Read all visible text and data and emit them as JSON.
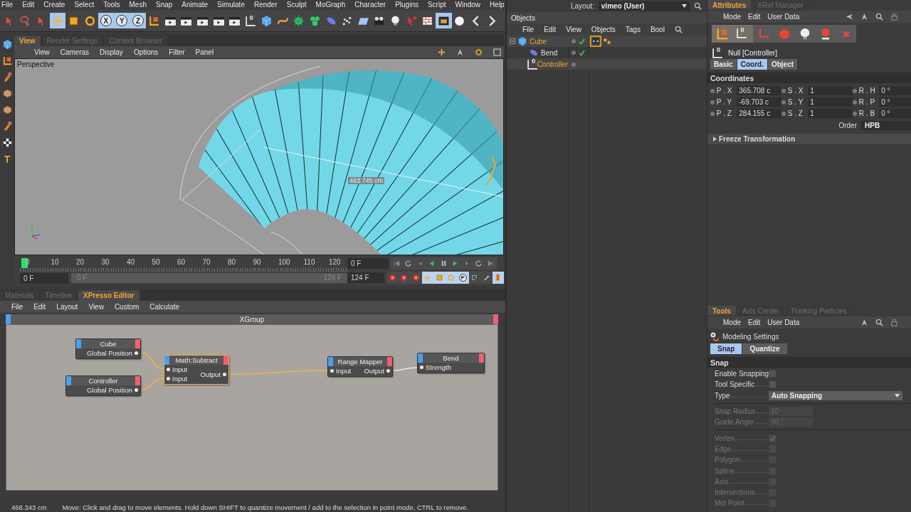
{
  "menubar": [
    "File",
    "Edit",
    "Create",
    "Select",
    "Tools",
    "Mesh",
    "Snap",
    "Animate",
    "Simulate",
    "Render",
    "Sculpt",
    "MoGraph",
    "Character",
    "Plugins",
    "Script",
    "Window",
    "Help"
  ],
  "toolbar": [
    {
      "kind": "select",
      "selected": false
    },
    {
      "kind": "lasso",
      "selected": false
    },
    {
      "kind": "select",
      "selected": false
    },
    {
      "kind": "move",
      "selected": true
    },
    {
      "kind": "scale",
      "selected": false
    },
    {
      "kind": "rotate",
      "selected": false
    },
    {
      "kind": "axis",
      "label": "X",
      "selected": true
    },
    {
      "kind": "axis",
      "label": "Y",
      "selected": true
    },
    {
      "kind": "axis",
      "label": "Z",
      "selected": true
    },
    {
      "kind": "coords",
      "selected": false
    },
    {
      "kind": "clapper",
      "selected": false
    },
    {
      "kind": "clapper",
      "selected": false
    },
    {
      "kind": "clapper",
      "selected": false
    },
    {
      "kind": "clapper",
      "selected": false
    },
    {
      "kind": "clapper",
      "selected": false
    },
    {
      "kind": "null",
      "label": "0",
      "selected": false
    },
    {
      "kind": "cube",
      "selected": false
    },
    {
      "kind": "spline",
      "selected": false
    },
    {
      "kind": "nurbs",
      "selected": false
    },
    {
      "kind": "array",
      "selected": false
    },
    {
      "kind": "deformer",
      "selected": false
    },
    {
      "kind": "particles",
      "selected": false
    },
    {
      "kind": "plane",
      "selected": false
    },
    {
      "kind": "camera",
      "selected": false
    },
    {
      "kind": "light",
      "selected": false
    },
    {
      "kind": "help",
      "selected": false
    },
    {
      "kind": "bricks",
      "selected": false
    },
    {
      "kind": "view",
      "selected": true
    },
    {
      "kind": "sphere",
      "selected": false
    },
    {
      "kind": "prev",
      "selected": false
    },
    {
      "kind": "next",
      "selected": false
    }
  ],
  "left_tools": [
    {
      "kind": "cube"
    },
    {
      "kind": "coords"
    },
    {
      "kind": "brush"
    },
    {
      "kind": "poly"
    },
    {
      "kind": "poly"
    },
    {
      "kind": "brush"
    },
    {
      "kind": "checker"
    },
    {
      "kind": "glyph",
      "label": "T"
    }
  ],
  "viewport": {
    "tabs": [
      {
        "label": "View",
        "selected": true
      },
      {
        "label": "Render Settings",
        "selected": false
      },
      {
        "label": "Content Browser",
        "selected": false
      }
    ],
    "menu": [
      "View",
      "Cameras",
      "Display",
      "Options",
      "Filter",
      "Panel"
    ],
    "camera": "Perspective",
    "measurement": "463.745 cm"
  },
  "timeline": {
    "ruler": [
      "0",
      "10",
      "20",
      "30",
      "40",
      "50",
      "60",
      "70",
      "80",
      "90",
      "100",
      "110",
      "120"
    ],
    "playhead": {
      "level": 0
    },
    "current_field": "0 F",
    "end_field": "124 F",
    "start_field": "0 F",
    "range_start": "0 F",
    "range_end": "124 F",
    "transport": [
      {
        "kind": "first",
        "selected": false
      },
      {
        "kind": "loop",
        "selected": false
      },
      {
        "kind": "prevkey",
        "selected": false
      },
      {
        "kind": "playback",
        "selected": false
      },
      {
        "kind": "pause",
        "selected": false
      },
      {
        "kind": "play",
        "selected": false
      },
      {
        "kind": "nextkey",
        "selected": false
      },
      {
        "kind": "loop",
        "selected": false
      },
      {
        "kind": "last",
        "selected": false
      }
    ],
    "keys": [
      {
        "kind": "record",
        "selected": false
      },
      {
        "kind": "record",
        "selected": false
      },
      {
        "kind": "record",
        "selected": false
      },
      {
        "kind": "move",
        "selected": true
      },
      {
        "kind": "scale",
        "selected": true
      },
      {
        "kind": "rotate",
        "selected": true
      },
      {
        "kind": "param",
        "label": "P",
        "selected": true
      },
      {
        "kind": "grid",
        "selected": false
      },
      {
        "kind": "key",
        "selected": false
      },
      {
        "kind": "film",
        "selected": true
      }
    ]
  },
  "bottom": {
    "tabs": [
      {
        "label": "Materials",
        "selected": false
      },
      {
        "label": "Timeline",
        "selected": false
      },
      {
        "label": "XPresso Editor",
        "selected": true
      }
    ],
    "menu": [
      "File",
      "Edit",
      "Layout",
      "View",
      "Custom",
      "Calculate"
    ],
    "xgroup": {
      "title": "XGroup",
      "nodes": [
        {
          "title": "Cube",
          "selected": false,
          "outputs": [
            "Global Position"
          ]
        },
        {
          "title": "Controller",
          "selected": false,
          "outputs": [
            "Global Position"
          ]
        },
        {
          "title": "Math:Subtract",
          "selected": true,
          "inputs": [
            "Input",
            "Input"
          ],
          "outputs": [
            "Output"
          ]
        },
        {
          "title": "Range Mapper",
          "selected": false,
          "inputs": [
            "Input"
          ],
          "outputs": [
            "Output"
          ]
        },
        {
          "title": "Bend",
          "selected": false,
          "inputs": [
            "Strength"
          ]
        }
      ],
      "wires": [
        {
          "selected": true
        },
        {
          "selected": true
        },
        {
          "selected": true
        },
        {
          "selected": false
        }
      ]
    }
  },
  "status": {
    "reading": "468.343 cm",
    "message": "Move: Click and drag to move elements. Hold down SHIFT to quantize movement / add to the selection in point mode, CTRL to remove."
  },
  "layout": {
    "label": "Layout:",
    "value": "vimeo (User)"
  },
  "objects": {
    "title": "Objects",
    "menu": [
      "File",
      "Edit",
      "View",
      "Objects",
      "Tags",
      "Bool"
    ],
    "tree": [
      {
        "name": "Cube",
        "kind": "cube",
        "selected": true,
        "expanded": true,
        "enabled": true,
        "tags": [
          {
            "kind": "xpresso",
            "selected": true
          },
          {
            "kind": "dots",
            "selected": false
          }
        ],
        "children": [
          {
            "name": "Bend",
            "kind": "deformer",
            "selected": false,
            "enabled": true
          },
          {
            "name": "Controller",
            "kind": "null",
            "label": "0",
            "selected": true,
            "enabled": false
          }
        ]
      }
    ]
  },
  "attributes": {
    "tabs": [
      {
        "label": "Attributes",
        "selected": true
      },
      {
        "label": "XRef Manager",
        "selected": false
      }
    ],
    "menu": [
      "Mode",
      "Edit",
      "User Data"
    ],
    "icons": [
      {
        "kind": "coords",
        "selected": true
      },
      {
        "kind": "null",
        "label": "0",
        "selected": true
      },
      {
        "kind": "joint",
        "selected": false
      },
      {
        "kind": "redball",
        "selected": false
      },
      {
        "kind": "bulb",
        "selected": false
      },
      {
        "kind": "pin",
        "selected": false
      },
      {
        "kind": "cross",
        "selected": false
      }
    ],
    "object": {
      "label": "0",
      "title": "Null [Controller]"
    },
    "subtabs": [
      {
        "label": "Basic",
        "selected": false
      },
      {
        "label": "Coord.",
        "selected": true
      },
      {
        "label": "Object",
        "selected": false
      }
    ],
    "section": "Coordinates",
    "fields": [
      {
        "label": "P . X",
        "value": "365.708 c"
      },
      {
        "label": "S . X",
        "value": "1"
      },
      {
        "label": "R . H",
        "value": "0 °"
      },
      {
        "label": "P . Y",
        "value": "-69.703 c"
      },
      {
        "label": "S . Y",
        "value": "1"
      },
      {
        "label": "R . P",
        "value": "0 °"
      },
      {
        "label": "P . Z",
        "value": "284.155 c"
      },
      {
        "label": "S . Z",
        "value": "1"
      },
      {
        "label": "R . B",
        "value": "0 °"
      }
    ],
    "order": {
      "label": "Order",
      "value": "HPB"
    },
    "freeze": {
      "title": "Freeze Transformation",
      "expanded": false
    }
  },
  "tools": {
    "tabs": [
      {
        "label": "Tools",
        "selected": true
      },
      {
        "label": "Axis Center",
        "selected": false
      },
      {
        "label": "Thinking Particles",
        "selected": false
      }
    ],
    "menu": [
      "Mode",
      "Edit",
      "User Data"
    ],
    "title": "Modeling Settings",
    "subtabs": [
      {
        "label": "Snap",
        "selected": true
      },
      {
        "label": "Quantize",
        "selected": false
      }
    ],
    "section": "Snap",
    "rows": [
      {
        "kind": "checkbox",
        "label": "Enable Snapping",
        "checked": false,
        "disabled": false
      },
      {
        "kind": "checkbox",
        "label": "Tool Specific",
        "checked": false,
        "disabled": false
      },
      {
        "kind": "dropdown",
        "label": "Type",
        "value": "Auto Snapping",
        "disabled": false
      },
      {
        "kind": "separator"
      },
      {
        "kind": "number",
        "label": "Snap Radius",
        "value": "10",
        "disabled": true
      },
      {
        "kind": "number",
        "label": "Guide Angle",
        "value": "90 °",
        "disabled": true
      },
      {
        "kind": "separator"
      },
      {
        "kind": "checkbox",
        "label": "Vertex",
        "checked": true,
        "disabled": true
      },
      {
        "kind": "checkbox",
        "label": "Edge",
        "checked": false,
        "disabled": true
      },
      {
        "kind": "checkbox",
        "label": "Polygon",
        "checked": false,
        "disabled": true
      },
      {
        "kind": "checkbox",
        "label": "Spline",
        "checked": false,
        "disabled": true
      },
      {
        "kind": "checkbox",
        "label": "Axis",
        "checked": false,
        "disabled": true
      },
      {
        "kind": "checkbox",
        "label": "Intersections",
        "checked": false,
        "disabled": true
      },
      {
        "kind": "checkbox",
        "label": "Mid Point",
        "checked": false,
        "disabled": true
      }
    ]
  }
}
